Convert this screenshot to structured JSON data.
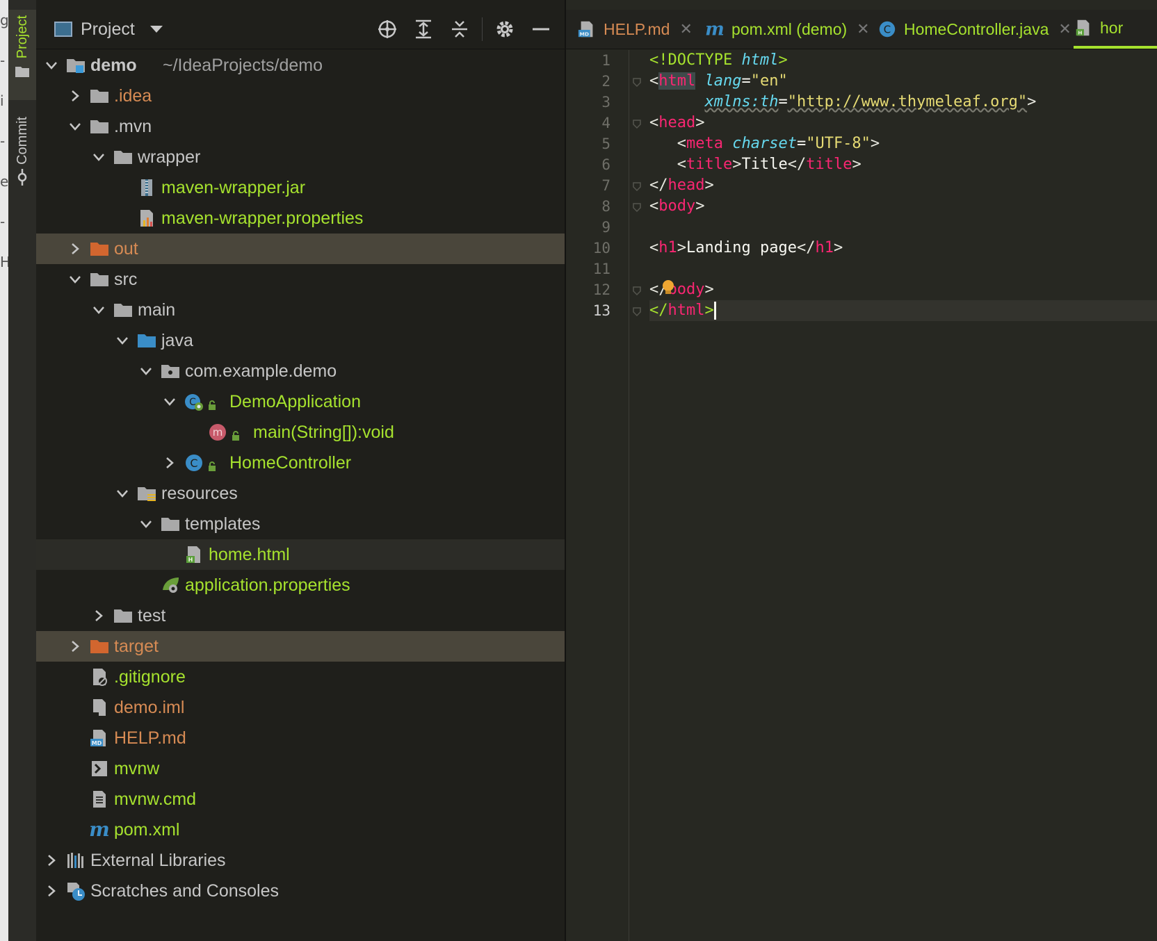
{
  "tool_window_tabs": {
    "project_label": "Project",
    "commit_label": "Commit"
  },
  "project_panel": {
    "title": "Project",
    "tree": [
      {
        "label": "demo",
        "path": "~/IdeaProjects/demo",
        "color": "grey",
        "depth": 0,
        "expanded": true,
        "icon": "module-folder-icon"
      },
      {
        "label": ".idea",
        "color": "orange",
        "depth": 1,
        "expanded": false,
        "icon": "folder-icon"
      },
      {
        "label": ".mvn",
        "color": "grey",
        "depth": 1,
        "expanded": true,
        "icon": "folder-icon"
      },
      {
        "label": "wrapper",
        "color": "grey",
        "depth": 2,
        "expanded": true,
        "icon": "folder-icon"
      },
      {
        "label": "maven-wrapper.jar",
        "color": "green",
        "depth": 3,
        "icon": "jar-icon"
      },
      {
        "label": "maven-wrapper.properties",
        "color": "green",
        "depth": 3,
        "icon": "properties-icon"
      },
      {
        "label": "out",
        "color": "orange",
        "depth": 1,
        "expanded": false,
        "icon": "excluded-folder-icon",
        "highlight": true
      },
      {
        "label": "src",
        "color": "grey",
        "depth": 1,
        "expanded": true,
        "icon": "folder-icon"
      },
      {
        "label": "main",
        "color": "grey",
        "depth": 2,
        "expanded": true,
        "icon": "folder-icon"
      },
      {
        "label": "java",
        "color": "grey",
        "depth": 3,
        "expanded": true,
        "icon": "source-folder-icon"
      },
      {
        "label": "com.example.demo",
        "color": "grey",
        "depth": 4,
        "expanded": true,
        "icon": "package-icon"
      },
      {
        "label": "DemoApplication",
        "color": "green",
        "depth": 5,
        "expanded": true,
        "icon": "spring-boot-class-icon"
      },
      {
        "label": "main(String[]):void",
        "color": "green",
        "depth": 6,
        "icon": "method-icon"
      },
      {
        "label": "HomeController",
        "color": "green",
        "depth": 5,
        "expanded": false,
        "icon": "class-icon"
      },
      {
        "label": "resources",
        "color": "grey",
        "depth": 3,
        "expanded": true,
        "icon": "resources-folder-icon"
      },
      {
        "label": "templates",
        "color": "grey",
        "depth": 4,
        "expanded": true,
        "icon": "folder-icon"
      },
      {
        "label": "home.html",
        "color": "green",
        "depth": 5,
        "icon": "html-file-icon",
        "selected": true
      },
      {
        "label": "application.properties",
        "color": "green",
        "depth": 4,
        "icon": "spring-properties-icon"
      },
      {
        "label": "test",
        "color": "grey",
        "depth": 2,
        "expanded": false,
        "icon": "folder-icon"
      },
      {
        "label": "target",
        "color": "orange",
        "depth": 1,
        "expanded": false,
        "icon": "excluded-folder-icon",
        "highlight": true
      },
      {
        "label": ".gitignore",
        "color": "green",
        "depth": 1,
        "icon": "gitignore-file-icon"
      },
      {
        "label": "demo.iml",
        "color": "orange",
        "depth": 1,
        "icon": "iml-file-icon"
      },
      {
        "label": "HELP.md",
        "color": "orange",
        "depth": 1,
        "icon": "markdown-file-icon"
      },
      {
        "label": "mvnw",
        "color": "green",
        "depth": 1,
        "icon": "shell-script-icon"
      },
      {
        "label": "mvnw.cmd",
        "color": "green",
        "depth": 1,
        "icon": "text-file-icon"
      },
      {
        "label": "pom.xml",
        "color": "green",
        "depth": 1,
        "icon": "maven-icon"
      },
      {
        "label": "External Libraries",
        "color": "grey",
        "depth": 0,
        "expanded": false,
        "icon": "libraries-icon"
      },
      {
        "label": "Scratches and Consoles",
        "color": "grey",
        "depth": 0,
        "expanded": false,
        "icon": "scratches-icon"
      }
    ]
  },
  "editor_tabs": [
    {
      "label": "HELP.md",
      "color": "orange",
      "icon": "markdown-file-icon",
      "closable": true
    },
    {
      "label": "pom.xml (demo)",
      "color": "green",
      "icon": "maven-icon",
      "closable": true
    },
    {
      "label": "HomeController.java",
      "color": "green",
      "icon": "class-icon",
      "closable": true
    },
    {
      "label": "hor",
      "color": "green",
      "icon": "html-file-icon",
      "active": true
    }
  ],
  "editor": {
    "line_numbers": [
      "1",
      "2",
      "3",
      "4",
      "5",
      "6",
      "7",
      "8",
      "9",
      "10",
      "11",
      "12",
      "13"
    ],
    "current_line": 13,
    "code_lines": [
      [
        {
          "c": "doc",
          "t": "<!DOCTYPE "
        },
        {
          "c": "dt",
          "t": "html"
        },
        {
          "c": "doc",
          "t": ">"
        }
      ],
      [
        {
          "c": "br",
          "t": "<"
        },
        {
          "c": "taghl",
          "t": "html"
        },
        {
          "c": "txt",
          "t": " "
        },
        {
          "c": "attr",
          "t": "lang"
        },
        {
          "c": "txt",
          "t": "="
        },
        {
          "c": "str",
          "t": "\"en\""
        }
      ],
      [
        {
          "c": "txt",
          "t": "      "
        },
        {
          "c": "attru",
          "t": "xmlns:th"
        },
        {
          "c": "txt",
          "t": "="
        },
        {
          "c": "stru",
          "t": "\"http://www.thymeleaf.org\""
        },
        {
          "c": "br",
          "t": ">"
        }
      ],
      [
        {
          "c": "br",
          "t": "<"
        },
        {
          "c": "tag",
          "t": "head"
        },
        {
          "c": "br",
          "t": ">"
        }
      ],
      [
        {
          "c": "txt",
          "t": "   "
        },
        {
          "c": "br",
          "t": "<"
        },
        {
          "c": "tag",
          "t": "meta"
        },
        {
          "c": "txt",
          "t": " "
        },
        {
          "c": "attr",
          "t": "charset"
        },
        {
          "c": "txt",
          "t": "="
        },
        {
          "c": "str",
          "t": "\"UTF-8\""
        },
        {
          "c": "br",
          "t": ">"
        }
      ],
      [
        {
          "c": "txt",
          "t": "   "
        },
        {
          "c": "br",
          "t": "<"
        },
        {
          "c": "tag",
          "t": "title"
        },
        {
          "c": "br",
          "t": ">"
        },
        {
          "c": "txt",
          "t": "Title"
        },
        {
          "c": "br",
          "t": "</"
        },
        {
          "c": "tag",
          "t": "title"
        },
        {
          "c": "br",
          "t": ">"
        }
      ],
      [
        {
          "c": "br",
          "t": "</"
        },
        {
          "c": "tag",
          "t": "head"
        },
        {
          "c": "br",
          "t": ">"
        }
      ],
      [
        {
          "c": "br",
          "t": "<"
        },
        {
          "c": "tag",
          "t": "body"
        },
        {
          "c": "br",
          "t": ">"
        }
      ],
      [],
      [
        {
          "c": "br",
          "t": "<"
        },
        {
          "c": "tag",
          "t": "h1"
        },
        {
          "c": "br",
          "t": ">"
        },
        {
          "c": "txt",
          "t": "Landing page"
        },
        {
          "c": "br",
          "t": "</"
        },
        {
          "c": "tag",
          "t": "h1"
        },
        {
          "c": "br",
          "t": ">"
        }
      ],
      [],
      [
        {
          "c": "br",
          "t": "</"
        },
        {
          "c": "tag",
          "t": "body"
        },
        {
          "c": "br",
          "t": ">"
        }
      ],
      [
        {
          "c": "doc",
          "t": "</"
        },
        {
          "c": "tag",
          "t": "html"
        },
        {
          "c": "doc",
          "t": ">"
        }
      ]
    ]
  },
  "colors": {
    "accent_green": "#a6e22e",
    "tag_pink": "#f92672",
    "attr_cyan": "#66d9ef",
    "string_yellow": "#e6db74",
    "excluded_orange": "#d78b54",
    "highlight_row": "#4a463b"
  }
}
